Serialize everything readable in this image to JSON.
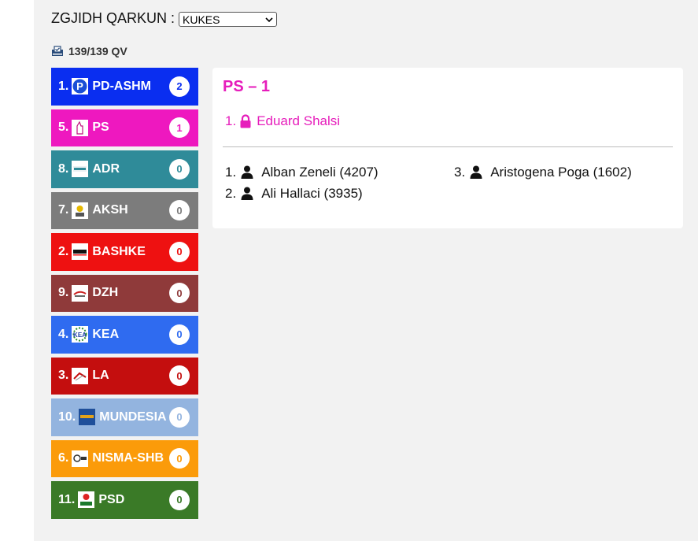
{
  "header": {
    "label": "ZGJIDH QARKUN :",
    "select_value": "KUKES"
  },
  "count_text": "139/139 QV",
  "parties": [
    {
      "num": "1.",
      "name": "PD-ASHM",
      "seats": "2",
      "color": "#0a2ef0"
    },
    {
      "num": "5.",
      "name": "PS",
      "seats": "1",
      "color": "#ee18bf"
    },
    {
      "num": "8.",
      "name": "ADR",
      "seats": "0",
      "color": "#2f8b99"
    },
    {
      "num": "7.",
      "name": "AKSH",
      "seats": "0",
      "color": "#7c7c7c"
    },
    {
      "num": "2.",
      "name": "BASHKE",
      "seats": "0",
      "color": "#ee1111"
    },
    {
      "num": "9.",
      "name": "DZH",
      "seats": "0",
      "color": "#8f3a3a"
    },
    {
      "num": "4.",
      "name": "KEA",
      "seats": "0",
      "color": "#2f6bf0"
    },
    {
      "num": "3.",
      "name": "LA",
      "seats": "0",
      "color": "#c40e0e"
    },
    {
      "num": "10.",
      "name": "MUNDESIA",
      "seats": "0",
      "color": "#93b4df"
    },
    {
      "num": "6.",
      "name": "NISMA-SHB",
      "seats": "0",
      "color": "#fb9b0a"
    },
    {
      "num": "11.",
      "name": "PSD",
      "seats": "0",
      "color": "#3a7a27"
    }
  ],
  "panel": {
    "title": "PS – 1",
    "elected": {
      "num": "1.",
      "name": "Eduard Shalsi"
    },
    "candidates": [
      {
        "num": "1.",
        "label": "Alban Zeneli (4207)"
      },
      {
        "num": "2.",
        "label": "Ali Hallaci (3935)"
      },
      {
        "num": "3.",
        "label": "Aristogena Poga (1602)"
      }
    ]
  }
}
